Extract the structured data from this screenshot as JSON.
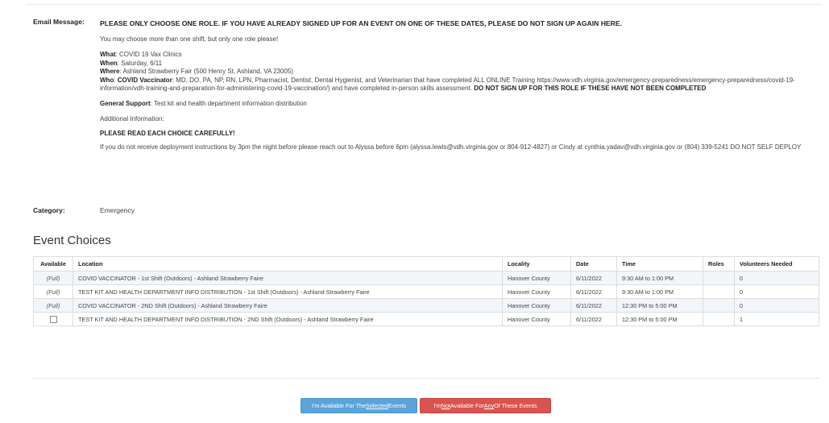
{
  "email_label": "Email Message:",
  "email": {
    "headline": "PLEASE ONLY CHOOSE ONE ROLE. IF YOU HAVE ALREADY SIGNED UP FOR AN EVENT ON ONE OF THESE DATES, PLEASE DO NOT SIGN UP AGAIN HERE.",
    "note": "You may choose more than one shift, but only one role please!",
    "what_label": "What",
    "what_value": ": COVID 19 Vax Clinics",
    "when_label": "When",
    "when_value": ": Saturday, 6/11",
    "where_label": "Where",
    "where_value": ":  Ashland Strawberry Fair (500 Henry St, Ashland, VA 23005)",
    "who_label": "Who",
    "who_colon": ":  ",
    "vaccinator_label": "COVID Vaccinator",
    "vaccinator_text": ": MD, DO, PA, NP, RN, LPN, Pharmacist, Dentist, Dental Hygienist, and Veterinarian that have completed ALL ONLINE Training https://www.vdh.virginia.gov/emergency-preparedness/emergency-preparedness/covid-19-information/vdh-training-and-preparation-for-administering-covid-19-vaccination/) and have completed in-person skills assessment. ",
    "vaccinator_warning": "DO NOT SIGN UP FOR THIS ROLE IF THESE HAVE NOT BEEN COMPLETED",
    "support_label": "General Support",
    "support_value": ": Test kit and health department information distribution",
    "additional": "Additional Information:",
    "read_carefully": "PLEASE READ EACH CHOICE CAREFULLY!",
    "deployment": "If you do not receive deployment instructions by 3pm the night before please reach out to Alyssa before 6pm (alyssa.lewis@vdh.virginia.gov or 804-912-4827) or Cindy at cynthia.yadav@vdh.virginia.gov or (804) 339-5241  DO NOT SELF DEPLOY"
  },
  "category_label": "Category:",
  "category_value": "Emergency",
  "section_title": "Event Choices",
  "table": {
    "headers": [
      "Available",
      "Location",
      "Locality",
      "Date",
      "Time",
      "Roles",
      "Volunteers Needed"
    ],
    "rows": [
      {
        "available": "(Full)",
        "location": "COVID VACCINATOR - 1st Shift (Outdoors) - Ashland Strawberry Faire",
        "locality": "Hanover County",
        "date": "6/11/2022",
        "time": "9:30 AM to 1:00 PM",
        "roles": "",
        "needed": "0"
      },
      {
        "available": "(Full)",
        "location": "TEST KIT AND HEALTH DEPARTMENT INFO DISTRIBUTION - 1st Shift (Outdoors) - Ashland Strawberry Faire",
        "locality": "Hanover County",
        "date": "6/11/2022",
        "time": "9:30 AM to 1:00 PM",
        "roles": "",
        "needed": "0"
      },
      {
        "available": "(Full)",
        "location": "COVID VACCINATOR - 2ND Shift (Outdoors) - Ashland Strawberry Faire",
        "locality": "Hanover County",
        "date": "6/11/2022",
        "time": "12:30 PM to 5:00 PM",
        "roles": "",
        "needed": "0"
      },
      {
        "available": "",
        "location": "TEST KIT AND HEALTH DEPARTMENT INFO DISTRIBUTION - 2ND Shift (Outdoors) - Ashland Strawberry Faire",
        "locality": "Hanover County",
        "date": "6/11/2022",
        "time": "12:30 PM to 5:00 PM",
        "roles": "",
        "needed": "1"
      }
    ]
  },
  "buttons": {
    "available_pre": "I'm Available For The ",
    "available_u": "Selected",
    "available_post": " Events",
    "not_pre": "I'm ",
    "not_u1": "Not",
    "not_mid": " Available For ",
    "not_u2": "Any",
    "not_post": " Of These Events"
  }
}
